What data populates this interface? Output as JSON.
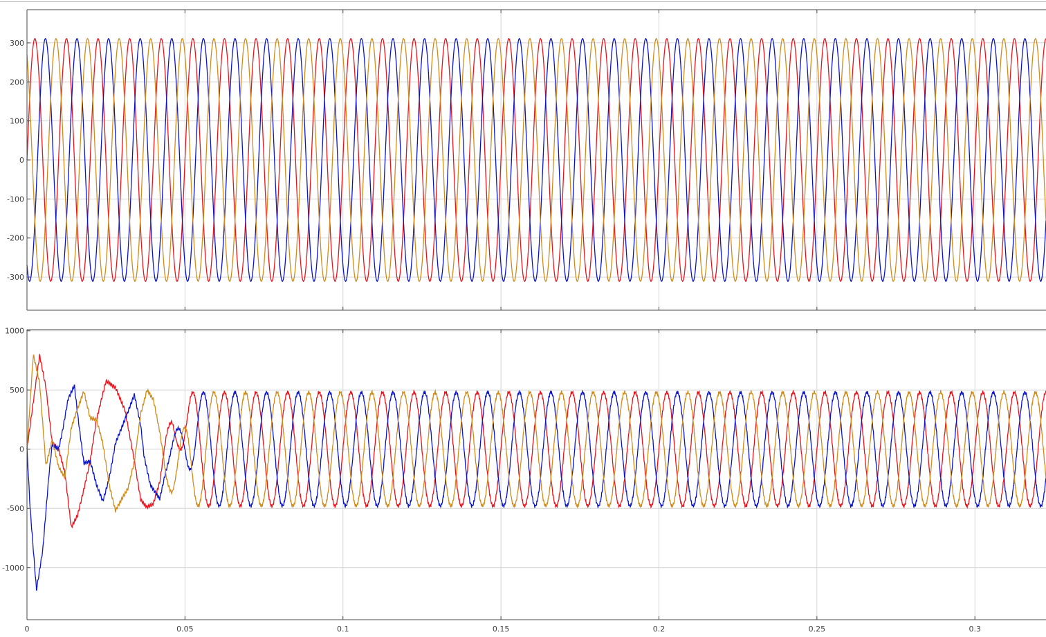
{
  "colors": {
    "red": "#e8141c",
    "blue": "#0a14c8",
    "orange": "#d08c1c",
    "grid": "#d4d4d4",
    "axis": "#4a4a4a",
    "background": "#ffffff"
  },
  "chart_data": [
    {
      "type": "line",
      "title": "",
      "xlabel": "",
      "ylabel": "",
      "xlim": [
        0,
        0.3225
      ],
      "ylim": [
        -385,
        385
      ],
      "xticks": [
        "0",
        "0.05",
        "0.1",
        "0.15",
        "0.2",
        "0.25",
        "0.3"
      ],
      "yticks": [
        "300",
        "200",
        "100",
        "0",
        "-100",
        "-200",
        "-300"
      ],
      "ytick_values": [
        300,
        200,
        100,
        0,
        -100,
        -200,
        -300
      ],
      "grid": true,
      "frequency_hz": 100,
      "amplitude": 311,
      "series": [
        {
          "color": "#e8141c",
          "amplitude": 311,
          "phase_deg": 0
        },
        {
          "color": "#0a14c8",
          "amplitude": 311,
          "phase_deg": -120
        },
        {
          "color": "#d08c1c",
          "amplitude": 311,
          "phase_deg": 120
        }
      ]
    },
    {
      "type": "line",
      "title": "",
      "xlabel": "",
      "ylabel": "",
      "xlim": [
        0,
        0.3225
      ],
      "ylim": [
        -1440,
        1010
      ],
      "xticks": [
        "0",
        "0.05",
        "0.1",
        "0.15",
        "0.2",
        "0.25",
        "0.3"
      ],
      "xtick_values": [
        0,
        0.05,
        0.1,
        0.15,
        0.2,
        0.25,
        0.3
      ],
      "yticks": [
        "1000",
        "500",
        "0",
        "-500",
        "-1000"
      ],
      "ytick_values": [
        1000,
        500,
        0,
        -500,
        -1000
      ],
      "grid": true,
      "steady_state_amplitude": 480,
      "series": [
        {
          "color": "#e8141c",
          "phase_deg": 0,
          "transient_points": [
            [
              0,
              0
            ],
            [
              0.002,
              400
            ],
            [
              0.004,
              795
            ],
            [
              0.006,
              520
            ],
            [
              0.008,
              50
            ],
            [
              0.01,
              0
            ],
            [
              0.012,
              -200
            ],
            [
              0.014,
              -660
            ],
            [
              0.016,
              -560
            ],
            [
              0.018,
              -340
            ],
            [
              0.02,
              -100
            ],
            [
              0.022,
              250
            ],
            [
              0.025,
              575
            ],
            [
              0.028,
              520
            ],
            [
              0.031,
              330
            ],
            [
              0.034,
              -100
            ],
            [
              0.036,
              -430
            ],
            [
              0.038,
              -490
            ],
            [
              0.04,
              -460
            ],
            [
              0.042,
              -280
            ],
            [
              0.044,
              80
            ],
            [
              0.046,
              400
            ],
            [
              0.048,
              490
            ]
          ]
        },
        {
          "color": "#0a14c8",
          "phase_deg": -120,
          "transient_points": [
            [
              0,
              0
            ],
            [
              0.001,
              -500
            ],
            [
              0.003,
              -1190
            ],
            [
              0.005,
              -850
            ],
            [
              0.007,
              -200
            ],
            [
              0.008,
              40
            ],
            [
              0.01,
              0
            ],
            [
              0.011,
              120
            ],
            [
              0.013,
              420
            ],
            [
              0.015,
              540
            ],
            [
              0.016,
              300
            ],
            [
              0.018,
              -120
            ],
            [
              0.02,
              -100
            ],
            [
              0.022,
              -300
            ],
            [
              0.024,
              -440
            ],
            [
              0.026,
              -250
            ],
            [
              0.028,
              50
            ],
            [
              0.031,
              250
            ],
            [
              0.034,
              460
            ],
            [
              0.036,
              200
            ],
            [
              0.037,
              -50
            ],
            [
              0.039,
              -300
            ],
            [
              0.042,
              -420
            ],
            [
              0.044,
              -180
            ],
            [
              0.046,
              0
            ],
            [
              0.048,
              200
            ],
            [
              0.05,
              410
            ]
          ]
        },
        {
          "color": "#d08c1c",
          "phase_deg": 120,
          "transient_points": [
            [
              0,
              0
            ],
            [
              0.002,
              800
            ],
            [
              0.004,
              560
            ],
            [
              0.006,
              -140
            ],
            [
              0.008,
              80
            ],
            [
              0.01,
              -150
            ],
            [
              0.012,
              -240
            ],
            [
              0.014,
              180
            ],
            [
              0.016,
              340
            ],
            [
              0.018,
              490
            ],
            [
              0.02,
              260
            ],
            [
              0.022,
              250
            ],
            [
              0.024,
              50
            ],
            [
              0.026,
              -300
            ],
            [
              0.028,
              -520
            ],
            [
              0.03,
              -420
            ],
            [
              0.032,
              -330
            ],
            [
              0.034,
              -100
            ],
            [
              0.036,
              300
            ],
            [
              0.038,
              500
            ],
            [
              0.04,
              420
            ],
            [
              0.042,
              150
            ],
            [
              0.044,
              -200
            ],
            [
              0.046,
              -420
            ],
            [
              0.048,
              -480
            ]
          ]
        }
      ]
    }
  ]
}
